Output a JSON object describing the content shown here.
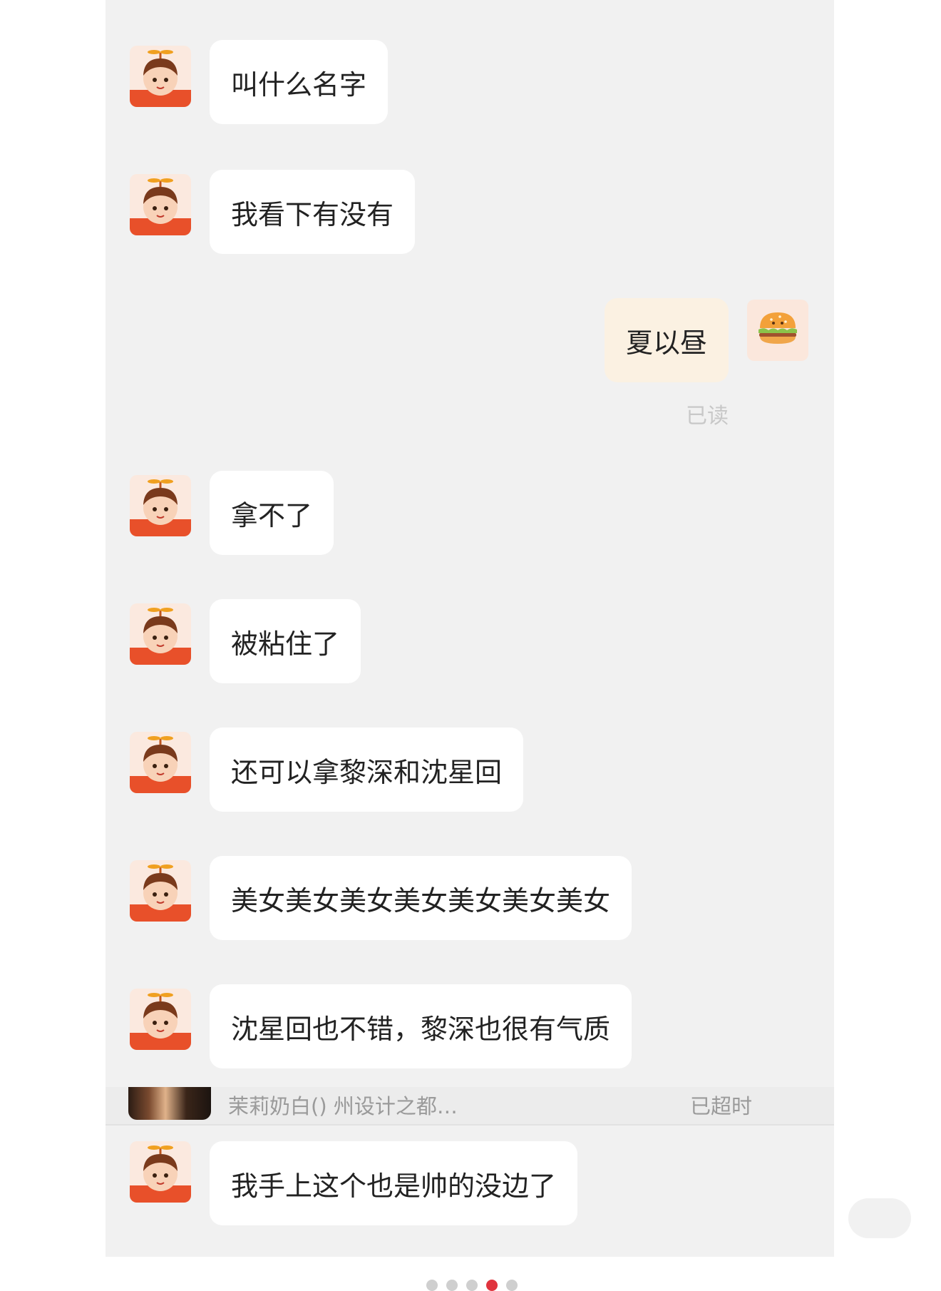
{
  "messages": [
    {
      "side": "left",
      "text": "叫什么名字"
    },
    {
      "side": "left",
      "text": "我看下有没有"
    },
    {
      "side": "right",
      "text": "夏以昼",
      "receipt": "已读"
    },
    {
      "side": "left",
      "text": "拿不了"
    },
    {
      "side": "left",
      "text": "被粘住了"
    },
    {
      "side": "left",
      "text": "还可以拿黎深和沈星回"
    },
    {
      "side": "left",
      "text": "美女美女美女美女美女美女美女"
    },
    {
      "side": "left",
      "text": "沈星回也不错，黎深也很有气质"
    },
    {
      "side": "left",
      "text": "我手上这个也是帅的没边了"
    }
  ],
  "notice": {
    "text": "茉莉奶白() 州设计之都…",
    "status": "已超时"
  },
  "icons": {
    "other_avatar": "propeller-hat-boy-avatar-icon",
    "self_avatar": "hamburger-avatar-icon"
  },
  "colors": {
    "chat_bg": "#f1f1f1",
    "incoming_bubble": "#ffffff",
    "outgoing_bubble": "#fbf1e2",
    "active_dot": "#e0343e"
  }
}
